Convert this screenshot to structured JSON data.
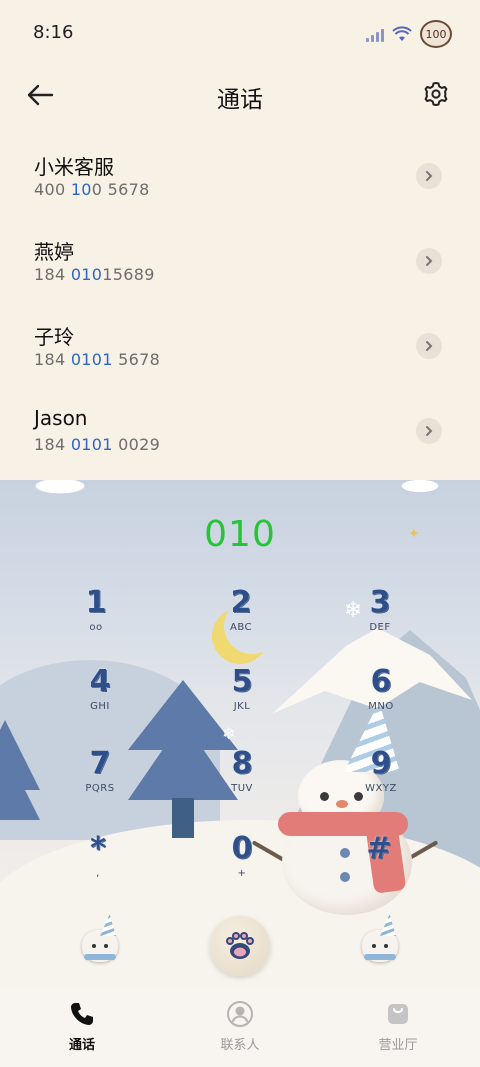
{
  "status_bar": {
    "time": "8:16",
    "battery": "100",
    "icons": [
      "signal-icon",
      "wifi-icon",
      "battery-icon"
    ]
  },
  "header": {
    "title": "通话",
    "back_icon": "arrow-left-icon",
    "settings_icon": "gear-icon"
  },
  "call_log": [
    {
      "name": "小米客服",
      "number_parts": [
        "400 ",
        "10",
        "0 5678"
      ]
    },
    {
      "name": "燕婷",
      "number_parts": [
        "184 ",
        "010",
        "15689"
      ]
    },
    {
      "name": "子玲",
      "number_parts": [
        "184 ",
        "0101",
        " 5678"
      ]
    },
    {
      "name": "Jason",
      "number_parts": [
        "184 ",
        "0101",
        " 0029"
      ]
    }
  ],
  "dialpad": {
    "input": "010",
    "keys": [
      {
        "digit": "1",
        "letters": "oo"
      },
      {
        "digit": "2",
        "letters": "ABC"
      },
      {
        "digit": "3",
        "letters": "DEF"
      },
      {
        "digit": "4",
        "letters": "GHI"
      },
      {
        "digit": "5",
        "letters": "JKL"
      },
      {
        "digit": "6",
        "letters": "MNO"
      },
      {
        "digit": "7",
        "letters": "PQRS"
      },
      {
        "digit": "8",
        "letters": "TUV"
      },
      {
        "digit": "9",
        "letters": "WXYZ"
      },
      {
        "digit": "*",
        "letters": ","
      },
      {
        "digit": "0",
        "letters": "+"
      },
      {
        "digit": "#",
        "letters": ""
      }
    ],
    "highlight_color": "#2b67c6",
    "input_color": "#27c43a"
  },
  "bottom_nav": [
    {
      "label": "通话",
      "icon": "phone-icon",
      "active": true
    },
    {
      "label": "联系人",
      "icon": "contact-icon",
      "active": false
    },
    {
      "label": "营业厅",
      "icon": "shop-bag-icon",
      "active": false
    }
  ]
}
